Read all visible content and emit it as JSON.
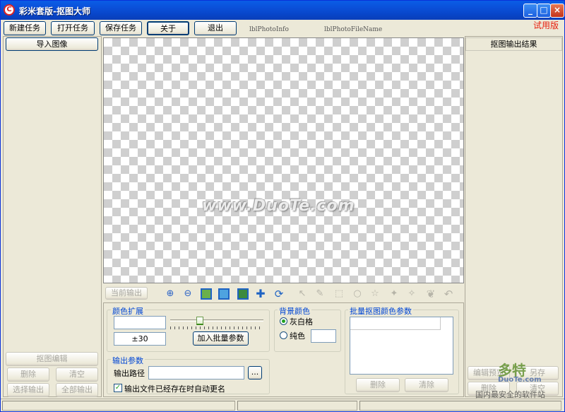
{
  "window": {
    "title": "彩米套版-抠图大师",
    "trial_label": "试用版"
  },
  "menu_buttons": [
    "新建任务",
    "打开任务",
    "保存任务",
    "关于",
    "退出"
  ],
  "info_labels": {
    "photo_info": "lblPhotoInfo",
    "photo_file_name": "lblPhotoFileName"
  },
  "left_panel": {
    "import_button": "导入图像",
    "edit_button": "抠图编辑",
    "delete_button": "删除",
    "clear_button": "清空",
    "select_output_button": "选择输出",
    "all_output_button": "全部输出"
  },
  "right_panel": {
    "title": "抠图输出结果",
    "preview_button": "编辑预览",
    "save_button": "另存",
    "delete_button": "删除",
    "clear_button": "清空"
  },
  "canvas": {
    "watermark": "www.DuoTe.com"
  },
  "toolbar": {
    "current_output_button": "当前输出",
    "icons": [
      "zoom-in-icon",
      "zoom-out-icon",
      "fit-window-icon",
      "actual-size-icon",
      "image-icon",
      "move-icon",
      "rotate-icon",
      "pointer-icon",
      "brush-icon",
      "rect-select-icon",
      "circle-select-icon",
      "lasso-icon",
      "polygon-icon",
      "magic-wand-icon",
      "leaf-icon",
      "undo-icon"
    ]
  },
  "color_expand": {
    "title": "颜色扩展",
    "tolerance_value": "±30",
    "slider_fraction": 0.3,
    "add_batch_button": "加入批量参数"
  },
  "background_color": {
    "title": "背景颜色",
    "options": [
      "灰白格",
      "纯色"
    ],
    "selected": "灰白格"
  },
  "batch_params": {
    "title": "批量抠图颜色参数",
    "delete_button": "删除",
    "clear_button": "清除"
  },
  "output_params": {
    "title": "输出参数",
    "path_label": "输出路径",
    "path_value": "",
    "browse_button": "...",
    "auto_rename_label": "输出文件已经存在时自动更名",
    "auto_rename_checked": true
  },
  "corner_watermark": {
    "brand": "多特",
    "site": "DuoTe.com",
    "slogan": "国内最安全的软件站"
  },
  "colors": {
    "title_bar": "#0a4fd8",
    "trial": "#e8210f",
    "group_title": "#0046d5"
  }
}
